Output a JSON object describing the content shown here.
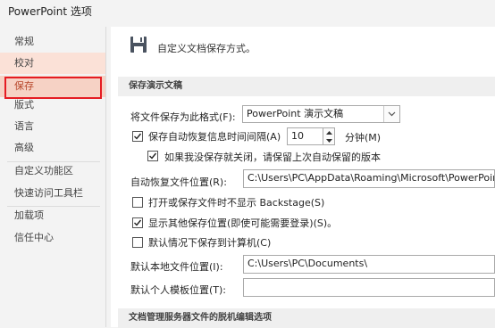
{
  "window": {
    "title": "PowerPoint 选项"
  },
  "sidebar": {
    "items": [
      {
        "label": "常规"
      },
      {
        "label": "校对"
      },
      {
        "label": "保存"
      },
      {
        "label": "版式"
      },
      {
        "label": "语言"
      },
      {
        "label": "高级"
      },
      {
        "label": "自定义功能区"
      },
      {
        "label": "快速访问工具栏"
      },
      {
        "label": "加载项"
      },
      {
        "label": "信任中心"
      }
    ],
    "selected": "保存"
  },
  "main": {
    "header": {
      "text": "自定义文档保存方式。",
      "icon": "save-icon"
    },
    "section1": {
      "title": "保存演示文稿"
    },
    "save_format": {
      "label": "将文件保存为此格式(F):",
      "value": "PowerPoint 演示文稿"
    },
    "autorecover_interval": {
      "label": "保存自动恢复信息时间间隔(A)",
      "checked": true,
      "value": "10",
      "unit": "分钟(M)"
    },
    "keep_last": {
      "label": "如果我没保存就关闭，请保留上次自动保留的版本",
      "checked": true
    },
    "autorecover_location": {
      "label": "自动恢复文件位置(R):",
      "value": "C:\\Users\\PC\\AppData\\Roaming\\Microsoft\\PowerPoin"
    },
    "no_backstage": {
      "label": "打开或保存文件时不显示 Backstage(S)",
      "checked": false
    },
    "show_other": {
      "label": "显示其他保存位置(即使可能需要登录)(S)。",
      "checked": true
    },
    "save_to_computer": {
      "label": "默认情况下保存到计算机(C)",
      "checked": false
    },
    "default_local": {
      "label": "默认本地文件位置(I):",
      "value": "C:\\Users\\PC\\Documents\\"
    },
    "default_template": {
      "label": "默认个人模板位置(T):",
      "value": ""
    },
    "section2": {
      "title": "文档管理服务器文件的脱机编辑选项"
    }
  },
  "colors": {
    "accent": "#b7472a",
    "highlight_box": "#e51c23",
    "sidebar_selected": "#f6d2c5"
  }
}
